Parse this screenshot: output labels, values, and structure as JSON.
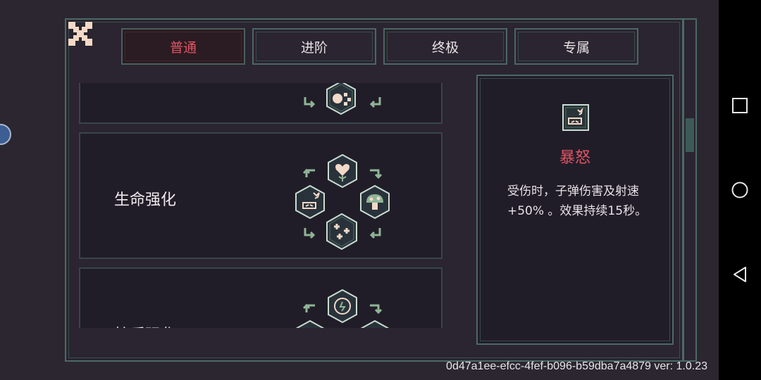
{
  "tabs": [
    {
      "label": "普通",
      "active": true
    },
    {
      "label": "进阶",
      "active": false
    },
    {
      "label": "终极",
      "active": false
    },
    {
      "label": "专属",
      "active": false
    }
  ],
  "cards": [
    {
      "title": ""
    },
    {
      "title": "生命强化"
    },
    {
      "title": "护盾强化"
    }
  ],
  "detail": {
    "name": "暴怒",
    "description": "受伤时，子弹伤害及射速 +50% 。效果持续15秒。"
  },
  "footer": {
    "build_id": "0d47a1ee-efcc-4fef-b096-b59dba7a4879 ver: 1.0.23"
  },
  "icons": {
    "close": "close-icon",
    "heart_flower": "heart-flower-icon",
    "rage": "rage-cloud-icon",
    "mushroom": "mushroom-icon",
    "sparkle": "sparkle-icon",
    "clock": "clock-icon"
  },
  "colors": {
    "accent_red": "#e05565",
    "frame_green": "#4b6a66",
    "hex_fill": "#29323a",
    "icon_cream": "#f2d9c8"
  },
  "system_nav": [
    "square-icon",
    "circle-icon",
    "triangle-back-icon"
  ]
}
